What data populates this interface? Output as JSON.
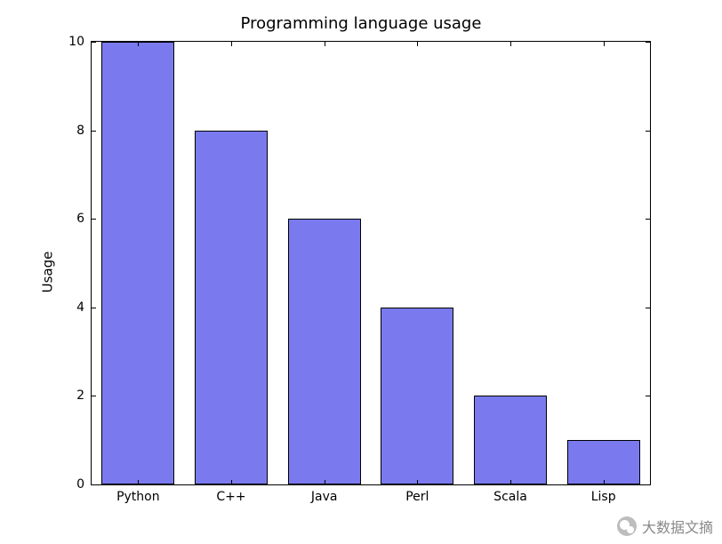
{
  "chart_data": {
    "type": "bar",
    "title": "Programming language usage",
    "ylabel": "Usage",
    "xlabel": "",
    "categories": [
      "Python",
      "C++",
      "Java",
      "Perl",
      "Scala",
      "Lisp"
    ],
    "values": [
      10,
      8,
      6,
      4,
      2,
      1
    ],
    "ylim": [
      0,
      10
    ],
    "yticks": [
      0,
      2,
      4,
      6,
      8,
      10
    ]
  },
  "watermark": {
    "text": "大数据文摘"
  }
}
